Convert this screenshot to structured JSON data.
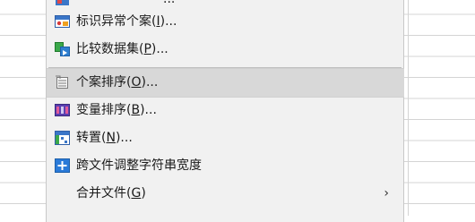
{
  "menu": {
    "items": [
      {
        "id": "partial",
        "label": "",
        "mnemonic": "",
        "suffix": "...",
        "icon": "define-dataset-icon"
      },
      {
        "id": "identify-unusual",
        "label": "标识异常个案(",
        "mnemonic": "I",
        "suffix": ")...",
        "icon": "unusual-cases-icon"
      },
      {
        "id": "compare-datasets",
        "label": "比较数据集(",
        "mnemonic": "P",
        "suffix": ")...",
        "icon": "compare-datasets-icon"
      },
      {
        "id": "sort-cases",
        "label": "个案排序(",
        "mnemonic": "O",
        "suffix": ")...",
        "icon": "sort-cases-icon",
        "highlighted": true
      },
      {
        "id": "sort-variables",
        "label": "变量排序(",
        "mnemonic": "B",
        "suffix": ")...",
        "icon": "sort-variables-icon"
      },
      {
        "id": "transpose",
        "label": "转置(",
        "mnemonic": "N",
        "suffix": ")...",
        "icon": "transpose-icon"
      },
      {
        "id": "adjust-string-widths",
        "label": "跨文件调整字符串宽度",
        "mnemonic": "",
        "suffix": "",
        "icon": "adjust-width-icon"
      },
      {
        "id": "merge-files",
        "label": "合并文件(",
        "mnemonic": "G",
        "suffix": ")",
        "icon": "",
        "submenu": "›"
      }
    ]
  },
  "colors": {
    "menu_bg": "#f1f1f1",
    "highlight": "#d8d8d8",
    "grid": "#d4d4d4"
  }
}
